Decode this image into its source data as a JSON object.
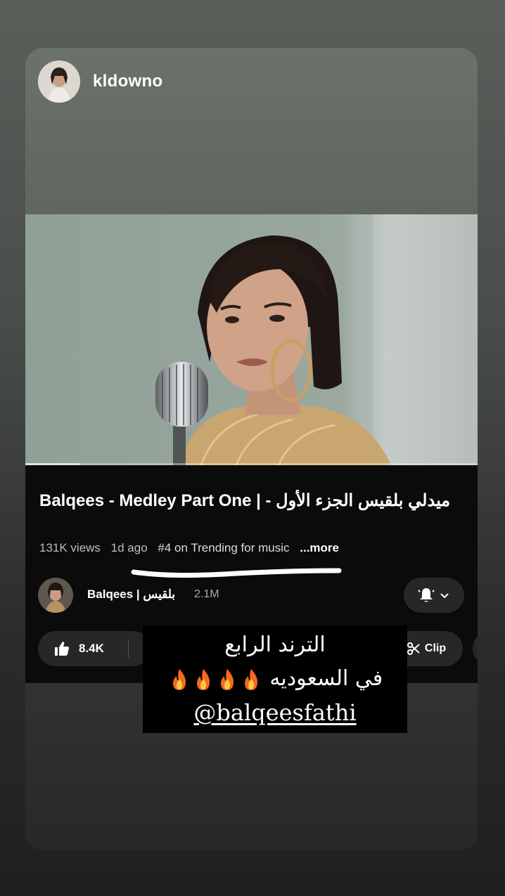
{
  "story": {
    "username": "kldowno"
  },
  "video": {
    "title": "Balqees - Medley Part One | - ميدلي بلقيس الجزء الأول",
    "views": "131K views",
    "age": "1d ago",
    "trending": "#4 on Trending for music",
    "more": "...more",
    "progress": 0.12
  },
  "channel": {
    "name": "Balqees | بلقيس",
    "subscribers": "2.1M"
  },
  "actions": {
    "likes": "8.4K",
    "clip_label": "Clip"
  },
  "sticker": {
    "line1": "الترند الرابع",
    "line2": "في السعوديه",
    "mention": "@balqeesfathi",
    "flame_count": 4
  },
  "icons": [
    "thumbs-up-icon",
    "bell-icon",
    "chevron-down-icon",
    "scissors-icon",
    "fire-icon"
  ]
}
